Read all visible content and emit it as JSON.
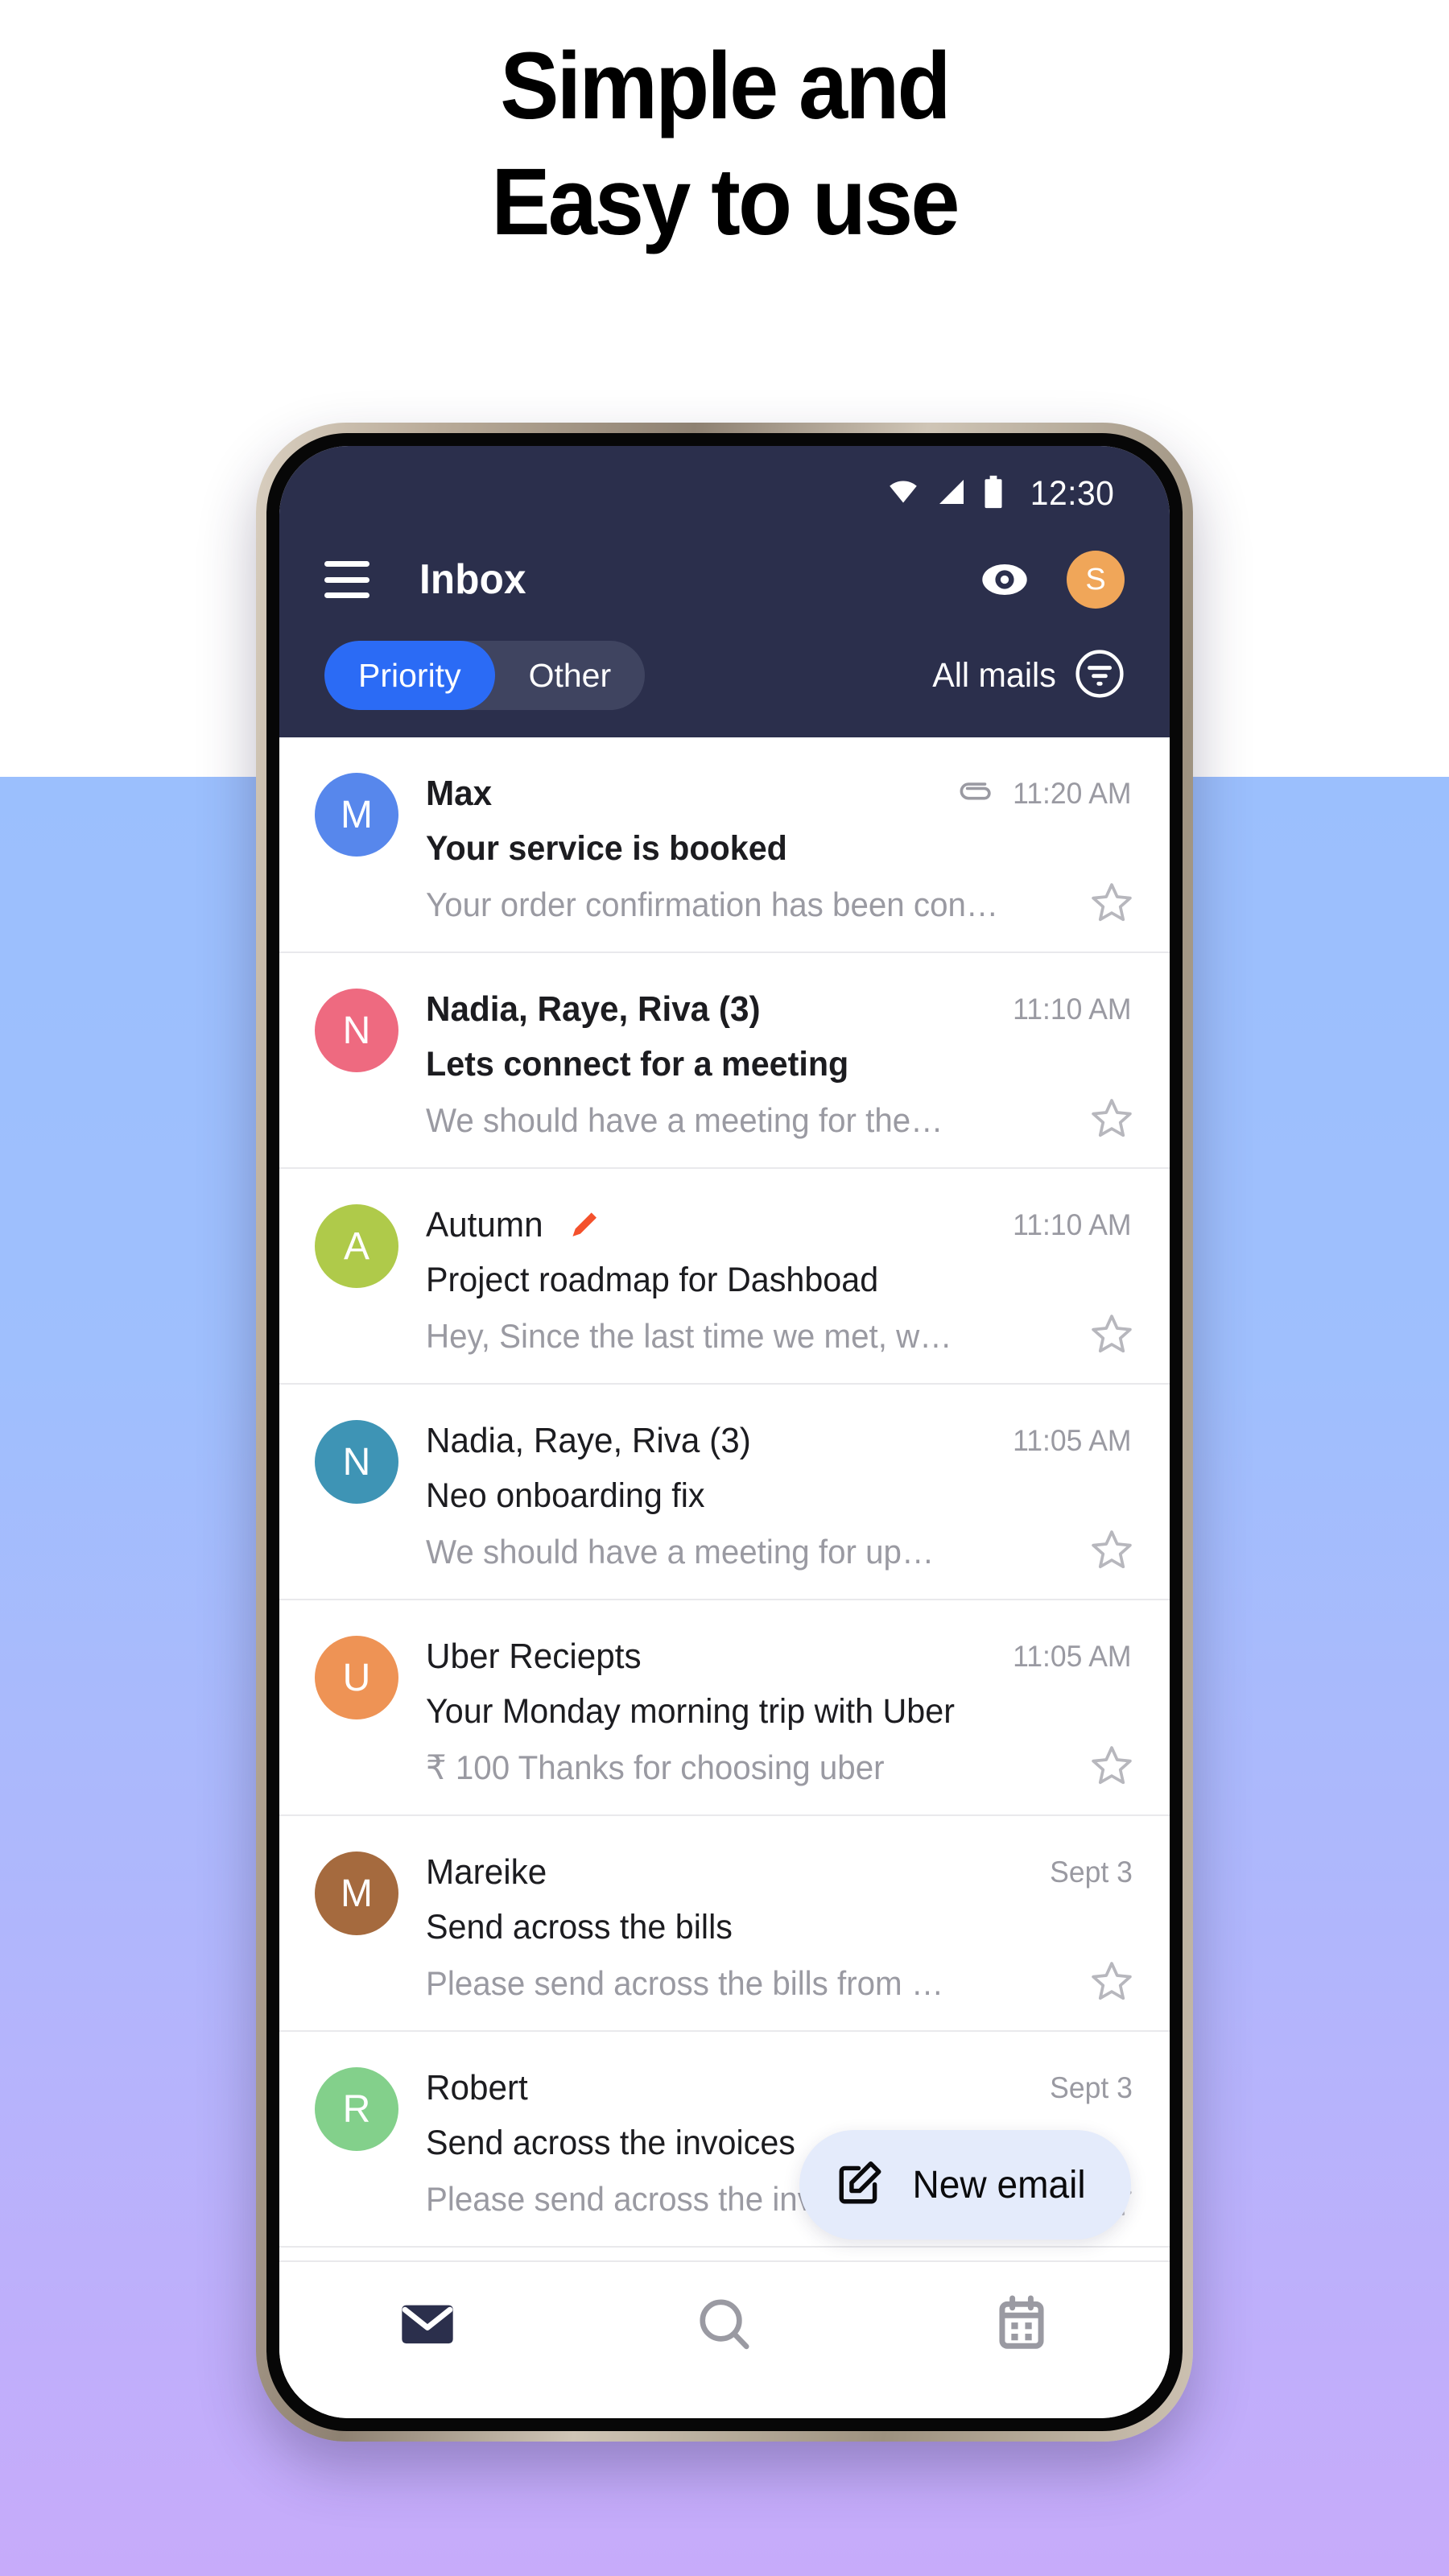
{
  "headline": {
    "line1": "Simple and",
    "line2": "Easy to use"
  },
  "colors": {
    "header_bg": "#2b2f4c",
    "accent_blue": "#2b6bf5",
    "backdrop_top": "#9BBFFD",
    "backdrop_bottom": "#C7ABFA",
    "fab_bg": "#e4ebfb",
    "avatar_orange": "#f0a659"
  },
  "status_bar": {
    "wifi_icon": "wifi-icon",
    "signal_icon": "cellular-signal-icon",
    "battery_icon": "battery-icon",
    "clock": "12:30"
  },
  "header": {
    "menu_icon": "hamburger-menu-icon",
    "title": "Inbox",
    "eye_icon": "eye-icon",
    "avatar_letter": "S"
  },
  "filter_bar": {
    "segments": [
      {
        "label": "Priority",
        "active": true
      },
      {
        "label": "Other",
        "active": false
      }
    ],
    "all_mails_label": "All mails",
    "filter_icon": "filter-list-icon"
  },
  "emails": [
    {
      "avatar_letter": "M",
      "avatar_color": "#5787EC",
      "sender": "Max",
      "unread": true,
      "has_attachment": true,
      "has_draft": false,
      "time": "11:20 AM",
      "subject": "Your service is booked",
      "preview": "Your order confirmation has been con…",
      "starred": false
    },
    {
      "avatar_letter": "N",
      "avatar_color": "#EE6A80",
      "sender": "Nadia, Raye, Riva (3)",
      "unread": true,
      "has_attachment": false,
      "has_draft": false,
      "time": "11:10 AM",
      "subject": "Lets connect for a meeting",
      "preview": "We should have a meeting for the…",
      "starred": false
    },
    {
      "avatar_letter": "A",
      "avatar_color": "#AFCA4A",
      "sender": "Autumn",
      "unread": false,
      "has_attachment": false,
      "has_draft": true,
      "time": "11:10 AM",
      "subject": "Project roadmap for Dashboad",
      "preview": "Hey, Since the last time we met, w…",
      "starred": false
    },
    {
      "avatar_letter": "N",
      "avatar_color": "#3E94B5",
      "sender": "Nadia, Raye, Riva (3)",
      "unread": false,
      "has_attachment": false,
      "has_draft": false,
      "time": "11:05 AM",
      "subject": "Neo onboarding fix",
      "preview": "We should have a meeting for  up…",
      "starred": false
    },
    {
      "avatar_letter": "U",
      "avatar_color": "#EE9355",
      "sender": "Uber Reciepts",
      "unread": false,
      "has_attachment": false,
      "has_draft": false,
      "time": "11:05 AM",
      "subject": "Your Monday morning trip with Uber",
      "preview": "₹ 100 Thanks for choosing uber",
      "starred": false
    },
    {
      "avatar_letter": "M",
      "avatar_color": "#A56A3E",
      "sender": "Mareike",
      "unread": false,
      "has_attachment": false,
      "has_draft": false,
      "time": "Sept 3",
      "subject": "Send across the bills",
      "preview": "Please send across the bills from …",
      "starred": false
    },
    {
      "avatar_letter": "R",
      "avatar_color": "#83D08B",
      "sender": "Robert",
      "unread": false,
      "has_attachment": false,
      "has_draft": false,
      "time": "Sept 3",
      "subject": "Send across the invoices",
      "preview": "Please send across the invoice numb…",
      "starred": false
    }
  ],
  "fab": {
    "icon": "compose-icon",
    "label": "New email"
  },
  "bottom_nav": [
    {
      "icon": "mail-icon",
      "active": true
    },
    {
      "icon": "search-icon",
      "active": false
    },
    {
      "icon": "calendar-icon",
      "active": false
    }
  ]
}
